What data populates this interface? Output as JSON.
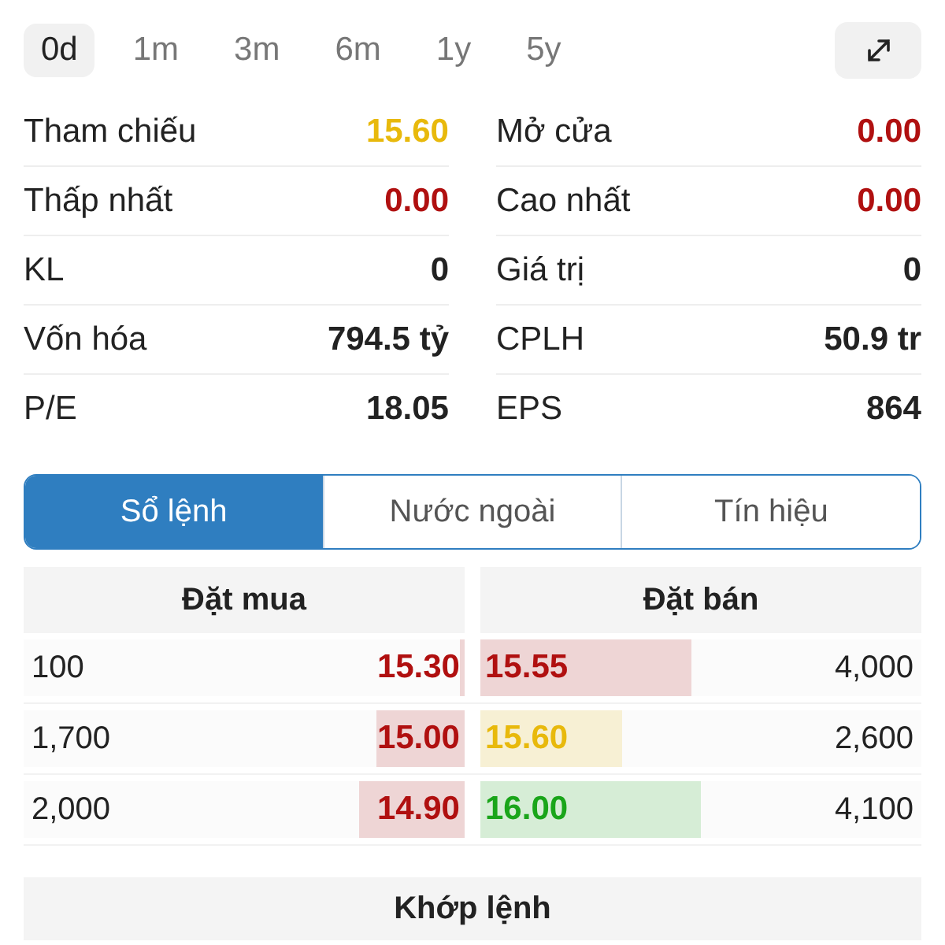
{
  "periods": [
    {
      "label": "0d",
      "selected": true
    },
    {
      "label": "1m",
      "selected": false
    },
    {
      "label": "3m",
      "selected": false
    },
    {
      "label": "6m",
      "selected": false
    },
    {
      "label": "1y",
      "selected": false
    },
    {
      "label": "5y",
      "selected": false
    }
  ],
  "stats": [
    [
      {
        "label": "Tham chiếu",
        "value": "15.60",
        "color": "#e8b90c"
      },
      {
        "label": "Mở cửa",
        "value": "0.00",
        "color": "#b01010"
      }
    ],
    [
      {
        "label": "Thấp nhất",
        "value": "0.00",
        "color": "#b01010"
      },
      {
        "label": "Cao nhất",
        "value": "0.00",
        "color": "#b01010"
      }
    ],
    [
      {
        "label": "KL",
        "value": "0",
        "color": "#222222"
      },
      {
        "label": "Giá trị",
        "value": "0",
        "color": "#222222"
      }
    ],
    [
      {
        "label": "Vốn hóa",
        "value": "794.5 tỷ",
        "color": "#222222"
      },
      {
        "label": "CPLH",
        "value": "50.9 tr",
        "color": "#222222"
      }
    ],
    [
      {
        "label": "P/E",
        "value": "18.05",
        "color": "#222222"
      },
      {
        "label": "EPS",
        "value": "864",
        "color": "#222222"
      }
    ]
  ],
  "tabs": [
    {
      "label": "Sổ lệnh",
      "selected": true
    },
    {
      "label": "Nước ngoài",
      "selected": false
    },
    {
      "label": "Tín hiệu",
      "selected": false
    }
  ],
  "order_book": {
    "buy_title": "Đặt mua",
    "sell_title": "Đặt bán",
    "rows": [
      {
        "buy": {
          "volume": "100",
          "price": "15.30",
          "color": "#b01010",
          "level": 0.01
        },
        "sell": {
          "price": "15.55",
          "color": "#b01010",
          "level": 0.48,
          "volume": "4,000"
        }
      },
      {
        "buy": {
          "volume": "1,700",
          "price": "15.00",
          "color": "#b01010",
          "level": 0.2
        },
        "sell": {
          "price": "15.60",
          "color": "#e8b90c",
          "level": 0.32,
          "volume": "2,600"
        }
      },
      {
        "buy": {
          "volume": "2,000",
          "price": "14.90",
          "color": "#b01010",
          "level": 0.24
        },
        "sell": {
          "price": "16.00",
          "color": "#1aa51a",
          "level": 0.5,
          "volume": "4,100"
        }
      }
    ]
  },
  "matched_title": "Khớp lệnh"
}
